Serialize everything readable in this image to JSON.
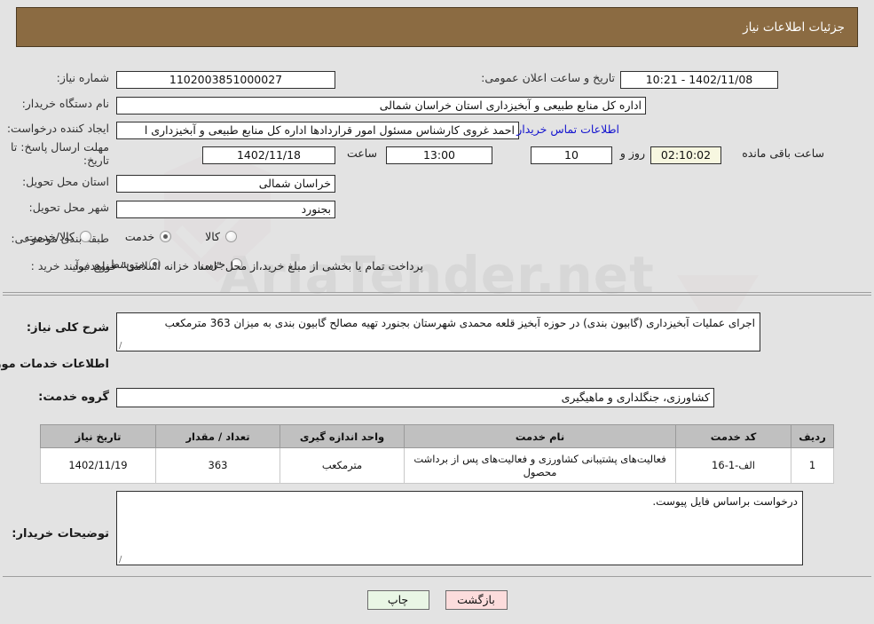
{
  "header": {
    "title": "جزئیات اطلاعات نیاز",
    "bg_color": "#8b6b42"
  },
  "watermark": {
    "text": "AriaTender.net"
  },
  "form": {
    "need_number": {
      "label": "شماره نیاز:",
      "value": "1102003851000027"
    },
    "announce_datetime": {
      "label": "تاریخ و ساعت اعلان عمومی:",
      "value": "1402/11/08 - 10:21"
    },
    "buyer_org": {
      "label": "نام دستگاه خریدار:",
      "value": "اداره کل منابع طبیعی و آبخیزداری استان خراسان شمالی"
    },
    "creator": {
      "label": "ایجاد کننده درخواست:",
      "value": "احمد غروی کارشناس مسئول امور قراردادها اداره کل منابع طبیعی و آبخیزداری ا",
      "contact_link": "اطلاعات تماس خریدار"
    },
    "deadline": {
      "label": "مهلت ارسال پاسخ: تا تاریخ:",
      "date": "1402/11/18",
      "time_label": "ساعت",
      "time": "13:00",
      "days": "10",
      "days_label": "روز و",
      "countdown": "02:10:02",
      "remaining_label": "ساعت باقی مانده"
    },
    "province": {
      "label": "استان محل تحویل:",
      "value": "خراسان شمالی"
    },
    "city": {
      "label": "شهر محل تحویل:",
      "value": "بجنورد"
    },
    "category": {
      "label": "طبقه بندی موضوعی:",
      "options": [
        {
          "label": "کالا",
          "selected": false
        },
        {
          "label": "خدمت",
          "selected": true
        },
        {
          "label": "کالا/خدمت",
          "selected": false
        }
      ]
    },
    "purchase_type": {
      "label": "نوع فرآیند خرید :",
      "options": [
        {
          "label": "جزیی",
          "selected": false
        },
        {
          "label": "متوسط",
          "selected": true
        }
      ],
      "note": "پرداخت تمام یا بخشی از مبلغ خرید،از محل \"اسناد خزانه اسلامی\" خواهد بود."
    }
  },
  "description": {
    "label": "شرح کلی نیاز:",
    "value": "اجرای عملیات آبخیزداری (گابیون بندی) در حوزه آبخیز قلعه محمدی  شهرستان بجنورد تهیه مصالح گابیون بندی به میزان 363 مترمکعب"
  },
  "services_section": {
    "heading": "اطلاعات خدمات مورد نیاز",
    "group": {
      "label": "گروه خدمت:",
      "value": "کشاورزی، جنگلداری و ماهیگیری"
    },
    "table": {
      "columns": [
        "ردیف",
        "کد خدمت",
        "نام خدمت",
        "واحد اندازه گیری",
        "تعداد / مقدار",
        "تاریخ نیاز"
      ],
      "rows": [
        {
          "row": "1",
          "code": "الف-1-16",
          "name": "فعالیت‌های پشتیبانی کشاورزی و فعالیت‌های پس از برداشت محصول",
          "unit": "مترمکعب",
          "qty": "363",
          "need_date": "1402/11/19"
        }
      ]
    }
  },
  "buyer_notes": {
    "label": "توضیحات خریدار:",
    "value": "درخواست براساس فایل پیوست."
  },
  "buttons": {
    "print": "چاپ",
    "back": "بازگشت"
  }
}
